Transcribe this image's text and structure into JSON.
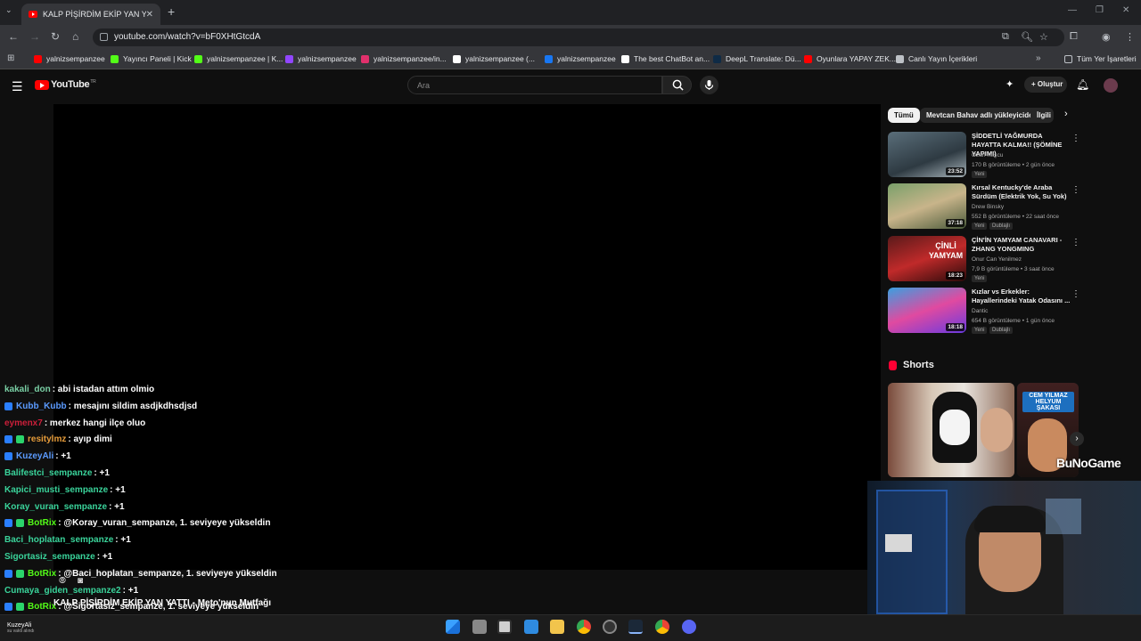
{
  "browser": {
    "tab_title": "KALP PİŞİRDİM EKİP YAN YATT",
    "url": "youtube.com/watch?v=bF0XHtGtcdA",
    "bookmarks": [
      {
        "label": "yalnizsempanzee",
        "color": "#ff0000"
      },
      {
        "label": "Yayıncı Paneli | Kick",
        "color": "#53fc18"
      },
      {
        "label": "yalnizsempanzee | K...",
        "color": "#53fc18"
      },
      {
        "label": "yalnizsempanzee",
        "color": "#9146ff"
      },
      {
        "label": "yalnizsempanzee/in...",
        "color": "#e1306c"
      },
      {
        "label": "yalnizsempanzee (...",
        "color": "#ffffff"
      },
      {
        "label": "yalnizsempanzee",
        "color": "#1877f2"
      },
      {
        "label": "The best ChatBot an...",
        "color": "#ffffff"
      },
      {
        "label": "DeepL Translate: Dü...",
        "color": "#0f2b46"
      },
      {
        "label": "Oyunlara YAPAY ZEK...",
        "color": "#ff0000"
      },
      {
        "label": "Canlı Yayın İçerikleri",
        "color": "#bdc1c6"
      }
    ],
    "all_bookmarks": "Tüm Yer İşaretleri"
  },
  "youtube": {
    "logo": "YouTube",
    "logo_country": "TR",
    "search_placeholder": "Ara",
    "create_label": "Oluştur",
    "chips": [
      "Tümü",
      "Mevtcan Bahav adlı yükleyiciden",
      "İlgili"
    ],
    "recommendations": [
      {
        "title": "ŞİDDETLİ YAĞMURDA HAYATTA KALMA!! (ŞÖMİNE YAPIMI)",
        "channel": "Ozan Kuşcu",
        "meta": "170 B görüntüleme • 2 gün önce",
        "duration": "23:52",
        "new": "Yeni",
        "dub": ""
      },
      {
        "title": "Kırsal Kentucky'de Araba Sürdüm (Elektrik Yok, Su Yok)",
        "channel": "Drew Binsky",
        "meta": "552 B görüntüleme • 22 saat önce",
        "duration": "37:18",
        "new": "Yeni",
        "dub": "Dublajlı"
      },
      {
        "title": "ÇİN'İN YAMYAM CANAVARI - ZHANG YONGMING",
        "channel": "Onur Can Yenilmez",
        "meta": "7,9 B görüntüleme • 3 saat önce",
        "duration": "18:23",
        "new": "Yeni",
        "dub": ""
      },
      {
        "title": "Kızlar vs Erkekler: Hayallerindeki Yatak Odasını ...",
        "channel": "Dantic",
        "meta": "654 B görüntüleme • 1 gün önce",
        "duration": "18:18",
        "new": "Yeni",
        "dub": "Dublajlı"
      }
    ],
    "shorts_label": "Shorts",
    "shorts_thumb_text": "CEM YILMAZ HELYUM ŞAKASI",
    "thumb_text_3": "ÇİNLİ YAMYAM"
  },
  "chat": [
    {
      "user": "kakali_don",
      "msg": ": abi istadan attım olmio",
      "color": "#7ad0a5",
      "badges": 0
    },
    {
      "user": "Kubb_Kubb",
      "msg": ": mesajını sildim asdjkdhsdjsd",
      "color": "#5b9bff",
      "badges": 1
    },
    {
      "user": "eymenx7",
      "msg": ": merkez hangi ilçe oluo",
      "color": "#cc1f3a",
      "badges": 0
    },
    {
      "user": "resitylmz",
      "msg": ": ayıp dimi",
      "color": "#e59b3a",
      "badges": 2
    },
    {
      "user": "KuzeyAli",
      "msg": ": +1",
      "color": "#5b9bff",
      "badges": 1
    },
    {
      "user": "Balifestci_sempanze",
      "msg": ": +1",
      "color": "#3ad49b",
      "badges": 0
    },
    {
      "user": "Kapici_musti_sempanze",
      "msg": ": +1",
      "color": "#3ad49b",
      "badges": 0
    },
    {
      "user": "Koray_vuran_sempanze",
      "msg": ": +1",
      "color": "#3ad49b",
      "badges": 0
    },
    {
      "user": "BotRix",
      "msg": ": @Koray_vuran_sempanze, 1. seviyeye yükseldin",
      "color": "#53fc18",
      "badges": 2
    },
    {
      "user": "Baci_hoplatan_sempanze",
      "msg": ": +1",
      "color": "#3ad49b",
      "badges": 0
    },
    {
      "user": "Sigortasiz_sempanze",
      "msg": ": +1",
      "color": "#3ad49b",
      "badges": 0
    },
    {
      "user": "BotRix",
      "msg": ": @Baci_hoplatan_sempanze, 1. seviyeye yükseldin",
      "color": "#53fc18",
      "badges": 2
    },
    {
      "user": "Cumaya_giden_sempanze2",
      "msg": ": +1",
      "color": "#3ad49b",
      "badges": 0
    },
    {
      "user": "BotRix",
      "msg": ": @Sigortasiz_sempanze, 1. seviyeye yükseldin",
      "color": "#53fc18",
      "badges": 2
    }
  ],
  "video_title_overlay": "KALP PİŞİRDİM EKİP YAN YATTI - Meto'nun Mutfağı",
  "brand_overlay": "BuNoGame",
  "taskbar": {
    "weather_user": "KuzeyAli",
    "weather_sub": "su vakti alındı"
  }
}
